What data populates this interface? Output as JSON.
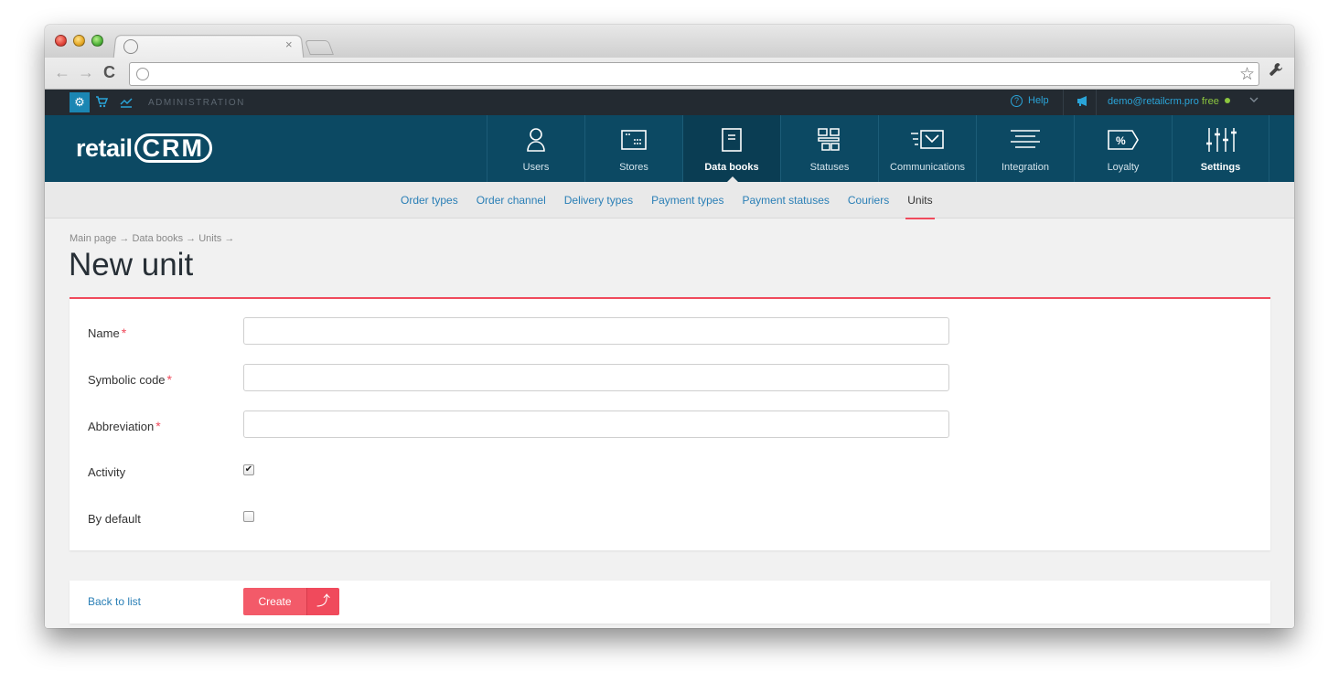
{
  "browser": {
    "tab_close": "×",
    "back": "←",
    "forward": "→",
    "reload": "C",
    "url": "",
    "star": "☆",
    "wrench": "🔧"
  },
  "topbar": {
    "admin_label": "ADMINISTRATION",
    "help_label": "Help",
    "user_email": "demo@retailcrm.pro",
    "plan": "free",
    "icons": [
      "gear-icon",
      "cart-icon",
      "chart-icon",
      "help-icon",
      "megaphone-icon",
      "chevron-down-icon"
    ]
  },
  "header": {
    "logo_prefix": "retail",
    "logo_suffix": "CRM",
    "nav": [
      {
        "label": "Users",
        "icon": "user-icon"
      },
      {
        "label": "Stores",
        "icon": "store-icon"
      },
      {
        "label": "Data books",
        "icon": "book-icon",
        "active": true
      },
      {
        "label": "Statuses",
        "icon": "statuses-icon"
      },
      {
        "label": "Communications",
        "icon": "communications-icon"
      },
      {
        "label": "Integration",
        "icon": "integration-icon"
      },
      {
        "label": "Loyalty",
        "icon": "loyalty-icon"
      },
      {
        "label": "Settings",
        "icon": "settings-icon"
      }
    ]
  },
  "subnav": {
    "items": [
      "Order types",
      "Order channel",
      "Delivery types",
      "Payment types",
      "Payment statuses",
      "Couriers",
      "Units"
    ],
    "active": "Units"
  },
  "breadcrumbs": "Main page → Data books → Units →",
  "page_title": "New unit",
  "form": {
    "required_mark": "*",
    "name_label": "Name",
    "name_value": "",
    "code_label": "Symbolic code",
    "code_value": "",
    "abbr_label": "Abbreviation",
    "abbr_value": "",
    "activity_label": "Activity",
    "activity_checked": true,
    "default_label": "By default",
    "default_checked": false
  },
  "footer": {
    "back_label": "Back to list",
    "create_label": "Create",
    "create_arrow": "⤴"
  },
  "colors": {
    "header_bg": "#0c4963",
    "topbar_bg": "#232a31",
    "accent_red": "#f04a5c",
    "link_blue": "#2a7fb6",
    "free_green": "#8cc63f"
  }
}
